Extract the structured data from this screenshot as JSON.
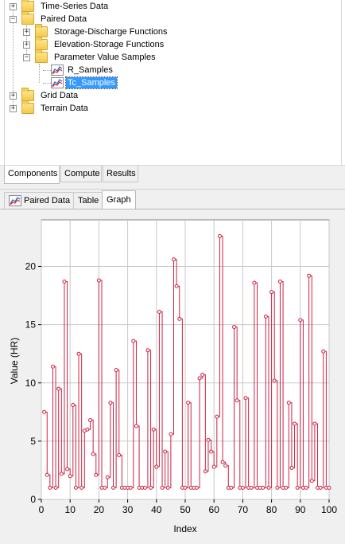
{
  "tree": {
    "items": [
      {
        "label": "Time-Series Data",
        "expander": "+"
      },
      {
        "label": "Paired Data",
        "expander": "−"
      },
      {
        "label": "Storage-Discharge Functions",
        "expander": "+"
      },
      {
        "label": "Elevation-Storage Functions",
        "expander": "+"
      },
      {
        "label": "Parameter Value Samples",
        "expander": "−"
      },
      {
        "label": "R_Samples"
      },
      {
        "label": "Tc_Samples"
      },
      {
        "label": "Grid Data",
        "expander": "+"
      },
      {
        "label": "Terrain Data",
        "expander": "+"
      }
    ]
  },
  "bottom_tabs": [
    "Components",
    "Compute",
    "Results"
  ],
  "view_tabs": [
    "Paired Data",
    "Table",
    "Graph"
  ],
  "colors": {
    "series": "#cc2244",
    "selection": "#3399ff",
    "folder": "#f3c94d"
  },
  "chart_data": {
    "type": "line",
    "step": true,
    "xlabel": "Index",
    "ylabel": "Value (HR)",
    "xlim": [
      0,
      100
    ],
    "ylim": [
      0,
      24
    ],
    "xticks": [
      0,
      10,
      20,
      30,
      40,
      50,
      60,
      70,
      80,
      90,
      100
    ],
    "yticks": [
      0,
      5,
      10,
      15,
      20
    ],
    "grid": true,
    "x": [
      1,
      2,
      3,
      4,
      5,
      6,
      7,
      8,
      9,
      10,
      11,
      12,
      13,
      14,
      15,
      16,
      17,
      18,
      19,
      20,
      21,
      22,
      23,
      24,
      25,
      26,
      27,
      28,
      29,
      30,
      31,
      32,
      33,
      34,
      35,
      36,
      37,
      38,
      39,
      40,
      41,
      42,
      43,
      44,
      45,
      46,
      47,
      48,
      49,
      50,
      51,
      52,
      53,
      54,
      55,
      56,
      57,
      58,
      59,
      60,
      61,
      62,
      63,
      64,
      65,
      66,
      67,
      68,
      69,
      70,
      71,
      72,
      73,
      74,
      75,
      76,
      77,
      78,
      79,
      80,
      81,
      82,
      83,
      84,
      85,
      86,
      87,
      88,
      89,
      90,
      91,
      92,
      93,
      94,
      95,
      96,
      97,
      98,
      99,
      100
    ],
    "values": [
      7.5,
      2.1,
      1.0,
      11.4,
      1.0,
      9.5,
      2.2,
      18.7,
      2.6,
      2.0,
      8.1,
      1.0,
      12.5,
      1.0,
      5.9,
      6.0,
      6.8,
      3.9,
      2.1,
      18.8,
      1.0,
      1.0,
      1.9,
      8.3,
      1.0,
      11.1,
      3.8,
      1.0,
      1.0,
      1.0,
      1.0,
      13.6,
      6.3,
      1.0,
      1.0,
      1.0,
      12.8,
      1.0,
      6.0,
      2.8,
      16.1,
      1.0,
      4.1,
      1.0,
      5.6,
      20.6,
      18.3,
      15.5,
      1.0,
      1.0,
      8.3,
      1.0,
      1.0,
      1.0,
      10.4,
      10.7,
      2.4,
      5.1,
      4.1,
      2.8,
      7.1,
      22.6,
      3.2,
      2.9,
      1.0,
      1.0,
      14.8,
      8.5,
      1.0,
      1.0,
      8.7,
      1.0,
      1.0,
      18.6,
      1.0,
      1.0,
      1.0,
      15.7,
      1.0,
      17.8,
      10.2,
      1.0,
      18.7,
      1.0,
      1.0,
      8.3,
      2.7,
      6.5,
      1.0,
      15.4,
      1.0,
      1.0,
      19.2,
      1.6,
      6.5,
      1.0,
      1.0,
      12.7,
      1.0,
      1.0
    ]
  }
}
